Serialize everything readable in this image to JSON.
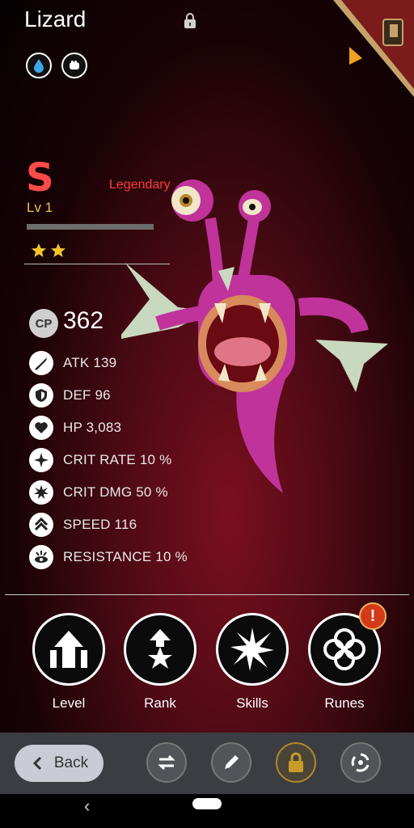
{
  "header": {
    "name": "Lizard",
    "elements": [
      "water-drop-icon",
      "fist-icon"
    ]
  },
  "rank": {
    "letter": "S",
    "level": "Lv 1",
    "xp_progress": 0,
    "rarity": "Legendary",
    "stars": 2,
    "colors": {
      "letter": "#ff4a4a",
      "level": "#e6c24a",
      "rarity": "#ff3b3b",
      "star": "#f2c62b"
    }
  },
  "cp": {
    "badge": "CP",
    "value": "362"
  },
  "stats": [
    {
      "icon": "sword-icon",
      "label": "ATK 139"
    },
    {
      "icon": "shield-icon",
      "label": "DEF 96"
    },
    {
      "icon": "heart-icon",
      "label": "HP 3,083"
    },
    {
      "icon": "crit-rate-icon",
      "label": "CRIT RATE 10 %"
    },
    {
      "icon": "crit-dmg-icon",
      "label": "CRIT DMG 50 %"
    },
    {
      "icon": "speed-icon",
      "label": "SPEED 116"
    },
    {
      "icon": "resistance-icon",
      "label": "RESISTANCE 10 %"
    }
  ],
  "actions": [
    {
      "icon": "level-up-arrows-icon",
      "label": "Level"
    },
    {
      "icon": "rank-star-icon",
      "label": "Rank"
    },
    {
      "icon": "skills-burst-icon",
      "label": "Skills"
    },
    {
      "icon": "runes-knot-icon",
      "label": "Runes",
      "alert": "!"
    }
  ],
  "bottom_bar": {
    "back_label": "Back",
    "buttons": [
      "swap-icon",
      "pencil-icon",
      "padlock-icon",
      "recycle-icon"
    ]
  },
  "system_nav": {
    "back_glyph": "‹"
  }
}
